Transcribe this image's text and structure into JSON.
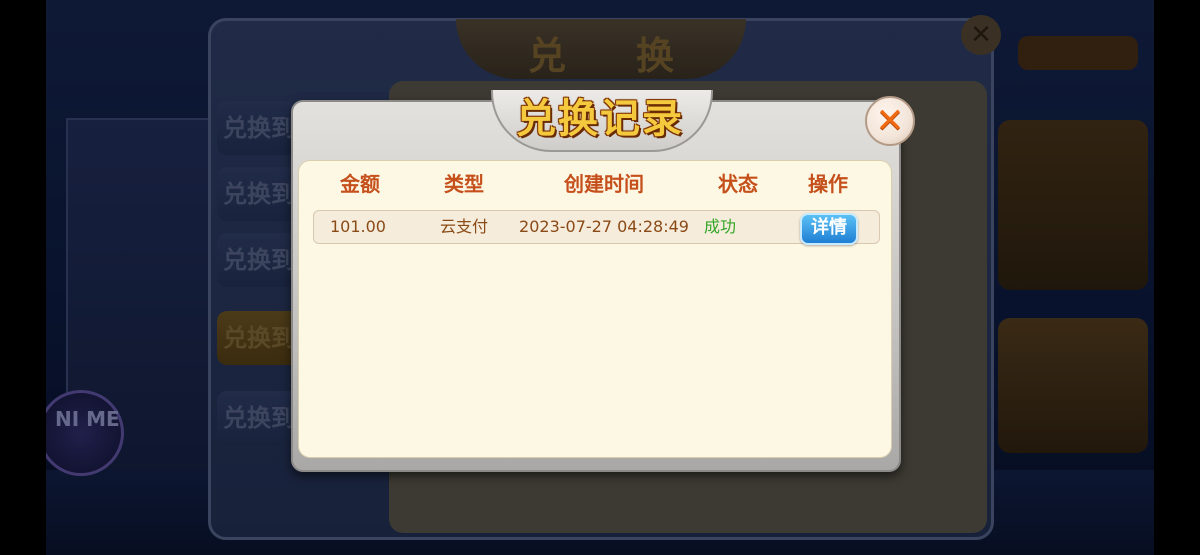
{
  "background": {
    "panel_title": "兑换",
    "tabs": [
      "兑换到",
      "兑换到",
      "兑换到",
      "兑换到",
      "兑换到"
    ],
    "badge_text": "NI ME"
  },
  "modal": {
    "title": "兑换记录",
    "close_icon": "close-x-icon",
    "columns": [
      "金额",
      "类型",
      "创建时间",
      "状态",
      "操作"
    ],
    "rows": [
      {
        "amount": "101.00",
        "type": "云支付",
        "created_at": "2023-07-27 04:28:49",
        "status": "成功",
        "action_label": "详情"
      }
    ]
  },
  "colors": {
    "header_text": "#c5501c",
    "cell_text": "#8a4a16",
    "status_success": "#35a627",
    "title_gold": "#f5c93e",
    "detail_button": "#1f7fd4",
    "content_bg": "#fdf8e4"
  }
}
